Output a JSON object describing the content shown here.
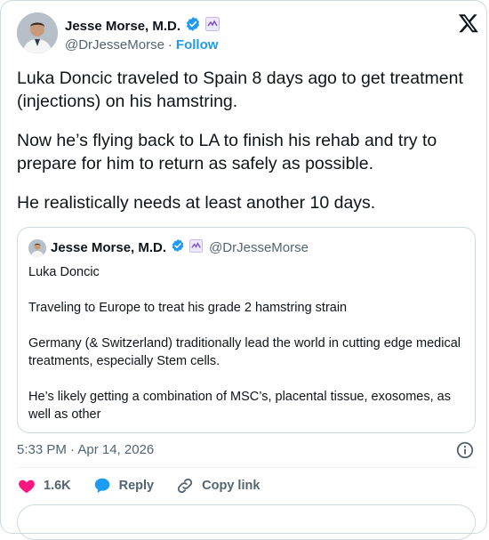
{
  "author": {
    "name": "Jesse Morse, M.D.",
    "handle": "@DrJesseMorse",
    "separator": "·",
    "follow_label": "Follow"
  },
  "tweet": {
    "paragraphs": [
      "Luka Doncic traveled to Spain 8 days ago to get treatment (injections) on his hamstring.",
      "Now he’s flying back to LA to finish his rehab and try to prepare for him to return as safely as possible.",
      "He realistically needs at least another 10 days."
    ],
    "timestamp": "5:33 PM · Apr 14, 2026"
  },
  "quoted": {
    "name": "Jesse Morse, M.D.",
    "handle": "@DrJesseMorse",
    "paragraphs": [
      "Luka Doncic",
      "Traveling to Europe to treat his grade 2 hamstring strain",
      "Germany (& Switzerland) traditionally lead the world in cutting edge medical treatments, especially Stem cells.",
      "He’s likely getting a combination of MSC’s, placental tissue, exosomes, as well as other"
    ]
  },
  "actions": {
    "like_count": "1.6K",
    "reply_label": "Reply",
    "copy_link_label": "Copy link"
  },
  "icons": {
    "verified": "verified-badge-icon",
    "affiliate": "affiliate-badge-icon",
    "x_logo": "x-logo-icon",
    "info": "info-icon",
    "like": "heart-icon",
    "reply": "reply-bubble-icon",
    "copy_link": "link-icon"
  },
  "colors": {
    "accent": "#1d9bf0",
    "like": "#f91880",
    "text": "#0f1419",
    "secondary": "#536471"
  }
}
